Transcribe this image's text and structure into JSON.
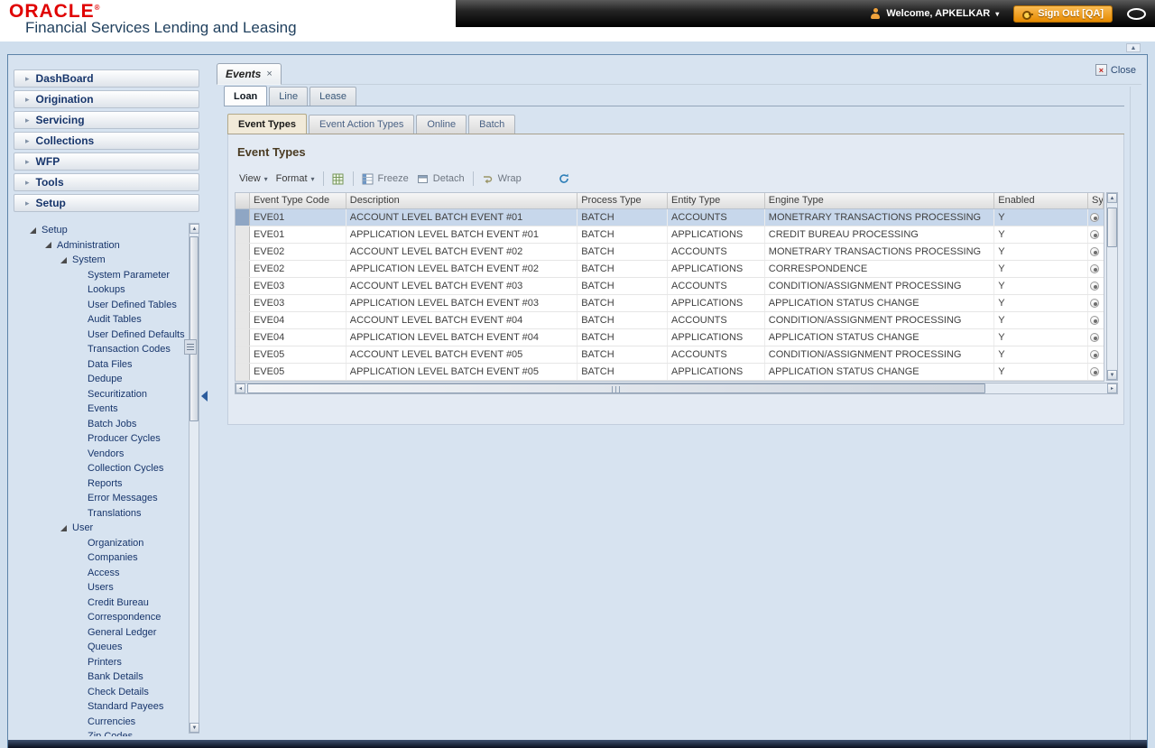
{
  "header": {
    "logo_text": "ORACLE",
    "registered_mark": "®",
    "product_name": "Financial Services Lending and Leasing",
    "welcome_label": "Welcome, APKELKAR",
    "sign_out_label": "Sign Out [QA]"
  },
  "icons": {
    "chevron_right": "▸",
    "dropdown_arrow": "▾",
    "tab_close": "×",
    "close_x": "×",
    "scroll_up": "▲",
    "scroll_down": "▼",
    "scroll_left": "◂",
    "scroll_right": "▸",
    "corner_scroll": "▲"
  },
  "sidebar": {
    "accordion": [
      "DashBoard",
      "Origination",
      "Servicing",
      "Collections",
      "WFP",
      "Tools",
      "Setup"
    ],
    "tree": [
      {
        "label": "Setup",
        "level": 0,
        "expandable": true
      },
      {
        "label": "Administration",
        "level": 1,
        "expandable": true
      },
      {
        "label": "System",
        "level": 2,
        "expandable": true
      },
      {
        "label": "System Parameter",
        "level": 3
      },
      {
        "label": "Lookups",
        "level": 3
      },
      {
        "label": "User Defined Tables",
        "level": 3
      },
      {
        "label": "Audit Tables",
        "level": 3
      },
      {
        "label": "User Defined Defaults",
        "level": 3
      },
      {
        "label": "Transaction Codes",
        "level": 3
      },
      {
        "label": "Data Files",
        "level": 3
      },
      {
        "label": "Dedupe",
        "level": 3
      },
      {
        "label": "Securitization",
        "level": 3
      },
      {
        "label": "Events",
        "level": 3
      },
      {
        "label": "Batch Jobs",
        "level": 3
      },
      {
        "label": "Producer Cycles",
        "level": 3
      },
      {
        "label": "Vendors",
        "level": 3
      },
      {
        "label": "Collection Cycles",
        "level": 3
      },
      {
        "label": "Reports",
        "level": 3
      },
      {
        "label": "Error Messages",
        "level": 3
      },
      {
        "label": "Translations",
        "level": 3
      },
      {
        "label": "User",
        "level": 2,
        "expandable": true
      },
      {
        "label": "Organization",
        "level": 3
      },
      {
        "label": "Companies",
        "level": 3
      },
      {
        "label": "Access",
        "level": 3
      },
      {
        "label": "Users",
        "level": 3
      },
      {
        "label": "Credit Bureau",
        "level": 3
      },
      {
        "label": "Correspondence",
        "level": 3
      },
      {
        "label": "General Ledger",
        "level": 3
      },
      {
        "label": "Queues",
        "level": 3
      },
      {
        "label": "Printers",
        "level": 3
      },
      {
        "label": "Bank Details",
        "level": 3
      },
      {
        "label": "Check Details",
        "level": 3
      },
      {
        "label": "Standard Payees",
        "level": 3
      },
      {
        "label": "Currencies",
        "level": 3
      },
      {
        "label": "Zip Codes",
        "level": 3
      }
    ]
  },
  "main": {
    "doc_tab_label": "Events",
    "close_label": "Close",
    "tabs": [
      "Loan",
      "Line",
      "Lease"
    ],
    "active_tab": 0,
    "subtabs": [
      "Event Types",
      "Event Action Types",
      "Online",
      "Batch"
    ],
    "active_subtab": 0,
    "panel_title": "Event Types",
    "toolbar": {
      "view_label": "View",
      "format_label": "Format",
      "freeze_label": "Freeze",
      "detach_label": "Detach",
      "wrap_label": "Wrap"
    },
    "table": {
      "columns": [
        "Event Type Code",
        "Description",
        "Process Type",
        "Entity Type",
        "Engine Type",
        "Enabled",
        "Sys"
      ],
      "selected_row": 0,
      "rows": [
        [
          "EVE01",
          "ACCOUNT LEVEL BATCH EVENT #01",
          "BATCH",
          "ACCOUNTS",
          "MONETRARY TRANSACTIONS PROCESSING",
          "Y"
        ],
        [
          "EVE01",
          "APPLICATION LEVEL BATCH EVENT #01",
          "BATCH",
          "APPLICATIONS",
          "CREDIT BUREAU PROCESSING",
          "Y"
        ],
        [
          "EVE02",
          "ACCOUNT LEVEL BATCH EVENT #02",
          "BATCH",
          "ACCOUNTS",
          "MONETRARY TRANSACTIONS PROCESSING",
          "Y"
        ],
        [
          "EVE02",
          "APPLICATION LEVEL BATCH EVENT #02",
          "BATCH",
          "APPLICATIONS",
          "CORRESPONDENCE",
          "Y"
        ],
        [
          "EVE03",
          "ACCOUNT LEVEL BATCH EVENT #03",
          "BATCH",
          "ACCOUNTS",
          "CONDITION/ASSIGNMENT PROCESSING",
          "Y"
        ],
        [
          "EVE03",
          "APPLICATION LEVEL BATCH EVENT #03",
          "BATCH",
          "APPLICATIONS",
          "APPLICATION STATUS CHANGE",
          "Y"
        ],
        [
          "EVE04",
          "ACCOUNT LEVEL BATCH EVENT #04",
          "BATCH",
          "ACCOUNTS",
          "CONDITION/ASSIGNMENT PROCESSING",
          "Y"
        ],
        [
          "EVE04",
          "APPLICATION LEVEL BATCH EVENT #04",
          "BATCH",
          "APPLICATIONS",
          "APPLICATION STATUS CHANGE",
          "Y"
        ],
        [
          "EVE05",
          "ACCOUNT LEVEL BATCH EVENT #05",
          "BATCH",
          "ACCOUNTS",
          "CONDITION/ASSIGNMENT PROCESSING",
          "Y"
        ],
        [
          "EVE05",
          "APPLICATION LEVEL BATCH EVENT #05",
          "BATCH",
          "APPLICATIONS",
          "APPLICATION STATUS CHANGE",
          "Y"
        ]
      ]
    }
  }
}
